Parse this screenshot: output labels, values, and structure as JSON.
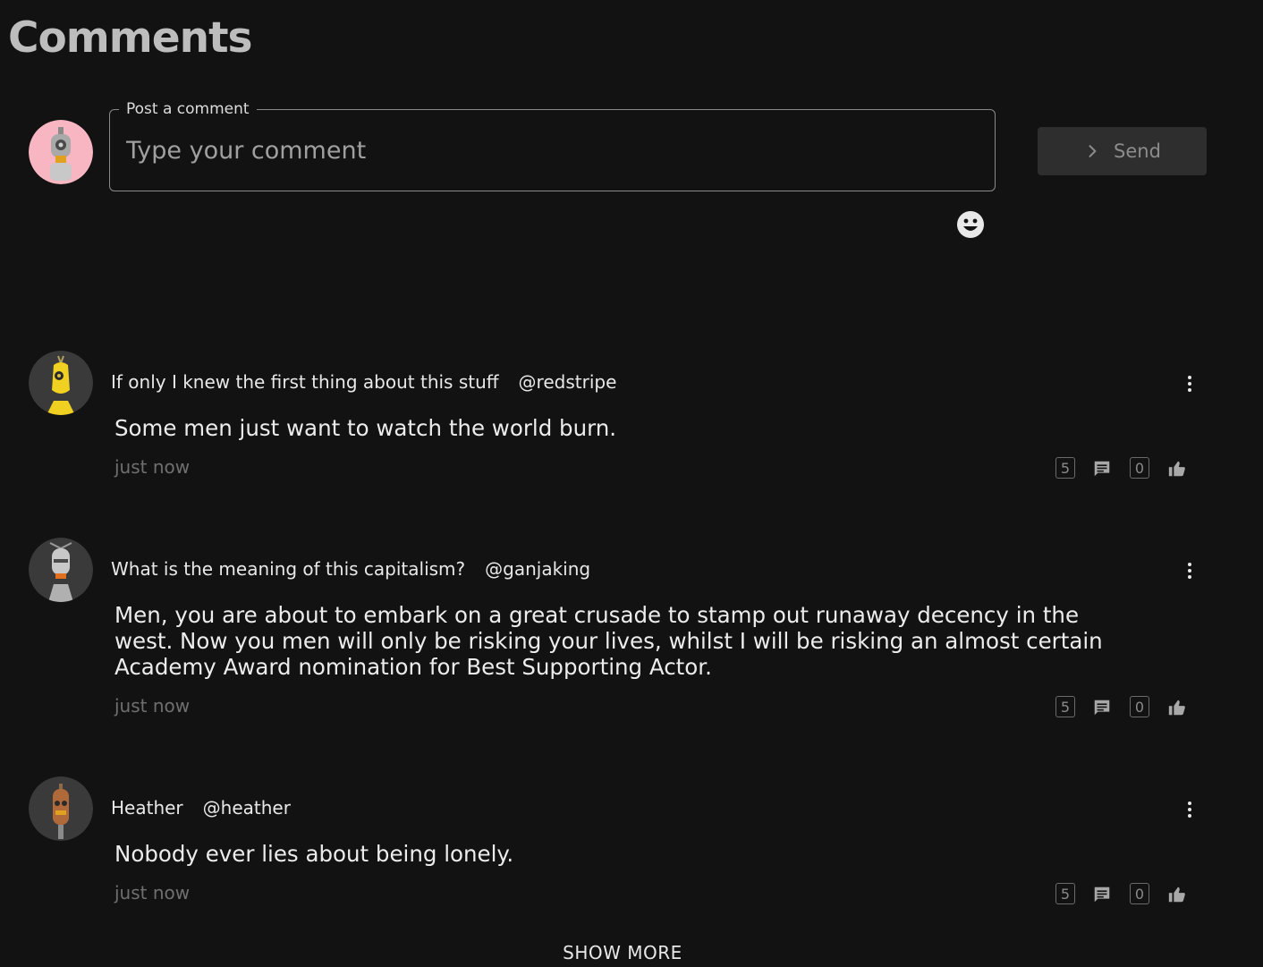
{
  "page": {
    "title": "Comments"
  },
  "composer": {
    "legend": "Post a comment",
    "placeholder": "Type your comment",
    "send_label": "Send",
    "avatar_bg": "#f7b6c2"
  },
  "comments": [
    {
      "author": "If only I knew the first thing about this stuff",
      "handle": "@redstripe",
      "body": "Some men just want to watch the world burn.",
      "time": "just now",
      "reply_count": "5",
      "like_count": "0"
    },
    {
      "author": "What is the meaning of this capitalism?",
      "handle": "@ganjaking",
      "body": "Men, you are about to embark on a great crusade to stamp out runaway decency in the west. Now you men will only be risking your lives, whilst I will be risking an almost certain Academy Award nomination for Best Supporting Actor.",
      "time": "just now",
      "reply_count": "5",
      "like_count": "0"
    },
    {
      "author": "Heather",
      "handle": "@heather",
      "body": "Nobody ever lies about being lonely.",
      "time": "just now",
      "reply_count": "5",
      "like_count": "0"
    }
  ],
  "show_more_label": "SHOW MORE",
  "colors": {
    "background": "#121212",
    "muted_text": "#6f6f6f",
    "send_bg": "#2e2e2e"
  }
}
